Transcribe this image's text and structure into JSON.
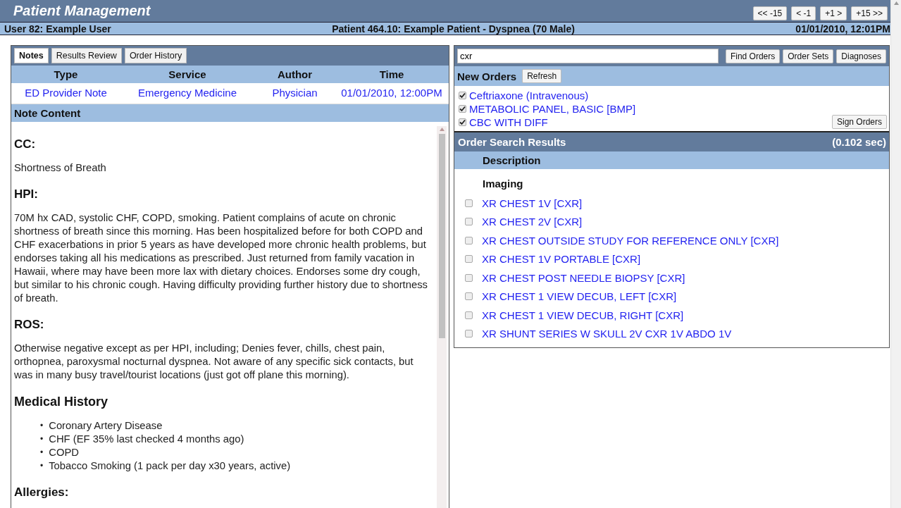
{
  "app_title": "Patient Management",
  "nav_buttons": [
    "<< -15",
    "< -1",
    "+1 >",
    "+15 >>"
  ],
  "info_bar": {
    "user": "User 82: Example User",
    "patient": "Patient 464.10: Example Patient - Dyspnea (70 Male)",
    "datetime": "01/01/2010, 12:01PM"
  },
  "left_panel": {
    "tabs": [
      {
        "label": "Notes",
        "selected": true
      },
      {
        "label": "Results Review",
        "selected": false
      },
      {
        "label": "Order History",
        "selected": false
      }
    ],
    "notes_table": {
      "columns": [
        "Type",
        "Service",
        "Author",
        "Time"
      ],
      "rows": [
        [
          "ED Provider Note",
          "Emergency Medicine",
          "Physician",
          "01/01/2010, 12:00PM"
        ]
      ]
    },
    "note_content_title": "Note Content",
    "note_sections": [
      {
        "kind": "heading",
        "text": "CC:"
      },
      {
        "kind": "paragraph",
        "text": "Shortness of Breath"
      },
      {
        "kind": "heading",
        "text": "HPI:"
      },
      {
        "kind": "paragraph",
        "text": "70M hx CAD, systolic CHF, COPD, smoking. Patient complains of acute on chronic shortness of breath since this morning. Has been hospitalized before for both COPD and CHF exacerbations in prior 5 years as have developed more chronic health problems, but endorses taking all his medications as prescribed. Just returned from family vacation in Hawaii, where may have been more lax with dietary choices. Endorses some dry cough, but similar to his chronic cough. Having difficulty providing further history due to shortness of breath."
      },
      {
        "kind": "heading",
        "text": "ROS:"
      },
      {
        "kind": "paragraph",
        "text": "Otherwise negative except as per HPI, including; Denies fever, chills, chest pain, orthopnea, paroxysmal nocturnal dyspnea. Not aware of any specific sick contacts, but was in many busy travel/tourist locations (just got off plane this morning)."
      },
      {
        "kind": "heading",
        "text": "Medical History"
      },
      {
        "kind": "bullets",
        "marker": "•",
        "items": [
          "Coronary Artery Disease",
          "CHF (EF 35% last checked 4 months ago)",
          "COPD",
          "Tobacco Smoking (1 pack per day x30 years, active)"
        ]
      },
      {
        "kind": "heading",
        "text": "Allergies:"
      }
    ]
  },
  "right_panel": {
    "search": {
      "value": "cxr"
    },
    "search_buttons": [
      "Find Orders",
      "Order Sets",
      "Diagnoses"
    ],
    "new_orders": {
      "title": "New Orders",
      "refresh_button": "Refresh",
      "items": [
        {
          "label": "Ceftriaxone (Intravenous)",
          "checked": true
        },
        {
          "label": "METABOLIC PANEL, BASIC [BMP]",
          "checked": true
        },
        {
          "label": "CBC WITH DIFF",
          "checked": true
        }
      ],
      "sign_button": "Sign Orders"
    },
    "search_results": {
      "title": "Order Search Results",
      "timing": "(0.102 sec)",
      "column": "Description",
      "group": "Imaging",
      "items": [
        {
          "label": "XR CHEST 1V [CXR]",
          "checked": false
        },
        {
          "label": "XR CHEST 2V [CXR]",
          "checked": false
        },
        {
          "label": "XR CHEST OUTSIDE STUDY FOR REFERENCE ONLY [CXR]",
          "checked": false
        },
        {
          "label": "XR CHEST 1V PORTABLE [CXR]",
          "checked": false
        },
        {
          "label": "XR CHEST POST NEEDLE BIOPSY [CXR]",
          "checked": false
        },
        {
          "label": "XR CHEST 1 VIEW DECUB, LEFT [CXR]",
          "checked": false
        },
        {
          "label": "XR CHEST 1 VIEW DECUB, RIGHT [CXR]",
          "checked": false
        },
        {
          "label": "XR SHUNT SERIES W SKULL 2V CXR 1V ABDO 1V",
          "checked": false
        }
      ]
    }
  }
}
